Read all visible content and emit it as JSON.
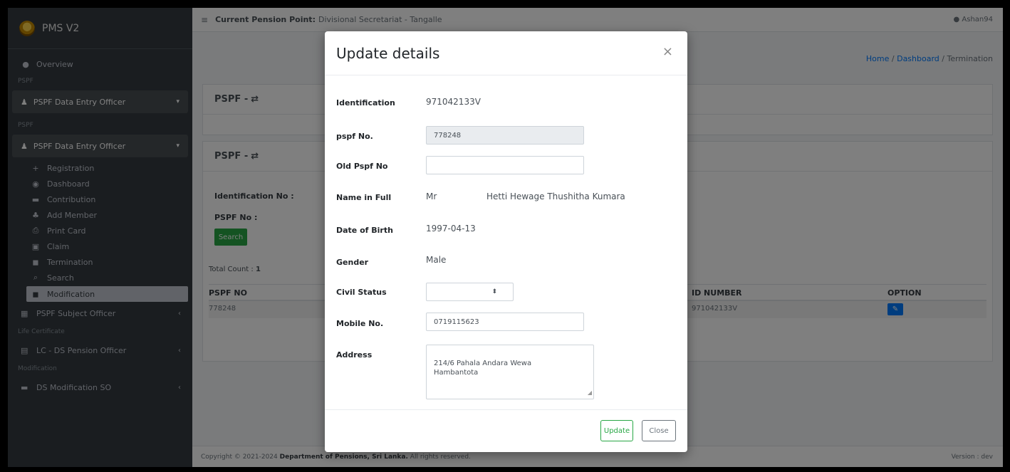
{
  "brand": {
    "name": "PMS V2"
  },
  "sidebar": {
    "overview": "Overview",
    "header1": "PSPF",
    "parent1": "PSPF Data Entry Officer",
    "header2": "PSPF",
    "parent2": "PSPF Data Entry Officer",
    "items": [
      {
        "label": "Registration",
        "icon": "plus-icon",
        "glyph": "+"
      },
      {
        "label": "Dashboard",
        "icon": "dashboard-icon",
        "glyph": "◉"
      },
      {
        "label": "Contribution",
        "icon": "card-icon",
        "glyph": "▬"
      },
      {
        "label": "Add Member",
        "icon": "add-member-icon",
        "glyph": "♣"
      },
      {
        "label": "Print Card",
        "icon": "print-icon",
        "glyph": "⎙"
      },
      {
        "label": "Claim",
        "icon": "claim-icon",
        "glyph": "▣"
      },
      {
        "label": "Termination",
        "icon": "termination-icon",
        "glyph": "◼"
      },
      {
        "label": "Search",
        "icon": "search-icon",
        "glyph": "⌕"
      },
      {
        "label": "Modification",
        "icon": "modification-icon",
        "glyph": "◼"
      }
    ],
    "subject_officer": "PSPF Subject Officer",
    "header3": "Life Certificate",
    "lc_officer": "LC - DS Pension Officer",
    "header4": "Modification",
    "ds_modification": "DS Modification SO"
  },
  "topbar": {
    "label": "Current Pension Point:",
    "point": "Divisional Secretariat - Tangalle",
    "user": "Ashan94"
  },
  "breadcrumb": {
    "home": "Home",
    "dashboard": "Dashboard",
    "current": "Termination"
  },
  "cards": {
    "title1": "PSPF -",
    "title2": "PSPF -"
  },
  "search_form": {
    "id_label": "Identification No :",
    "pspf_label": "PSPF No :",
    "button": "Search"
  },
  "results": {
    "total_label": "Total Count :",
    "total_value": "1",
    "headers": {
      "pspf_no": "PSPF NO",
      "id_number": "ID NUMBER",
      "option": "OPTION"
    },
    "row": {
      "pspf_no": "778248",
      "id_number": "971042133V"
    }
  },
  "footer": {
    "copyright": "Copyright © 2021-2024",
    "org": "Department of Pensions, Sri Lanka.",
    "rights": "All rights reserved.",
    "version": "Version : dev"
  },
  "modal": {
    "title": "Update details",
    "close_glyph": "×",
    "fields": {
      "identification_label": "Identification",
      "identification_value": "971042133V",
      "pspf_label": "pspf No.",
      "pspf_value": "778248",
      "old_pspf_label": "Old Pspf No",
      "old_pspf_value": "",
      "name_label": "Name in Full",
      "name_title": "Mr",
      "name_value": "Hetti Hewage Thushitha Kumara",
      "dob_label": "Date of Birth",
      "dob_value": "1997-04-13",
      "gender_label": "Gender",
      "gender_value": "Male",
      "civil_label": "Civil Status",
      "civil_value": "",
      "mobile_label": "Mobile No.",
      "mobile_value": "0719115623",
      "address_label": "Address",
      "address_value": "214/6 Pahala Andara Wewa\nHambantota"
    },
    "update_button": "Update",
    "close_button": "Close"
  }
}
